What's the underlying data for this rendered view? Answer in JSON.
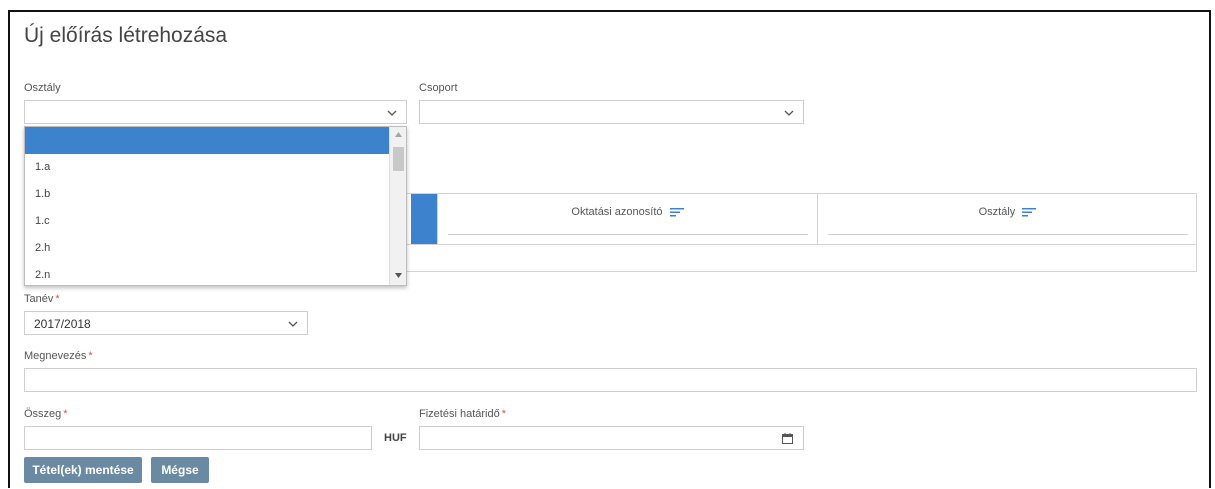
{
  "page": {
    "title": "Új előírás létrehozása"
  },
  "class_select": {
    "label": "Osztály",
    "value": "",
    "icon": "chevron-down-icon",
    "options": [
      "",
      "1.a",
      "1.b",
      "1.c",
      "2.h",
      "2.n"
    ],
    "selected_color": "#3d82cc"
  },
  "group_select": {
    "label": "Csoport",
    "value": "",
    "icon": "chevron-down-icon"
  },
  "table": {
    "columns": [
      {
        "label": "Oktatási azonosító",
        "icon": "filter-icon"
      },
      {
        "label": "Osztály",
        "icon": "filter-icon"
      }
    ]
  },
  "school_year": {
    "label": "Tanév",
    "required_mark": "*",
    "value": "2017/2018"
  },
  "name_field": {
    "label": "Megnevezés",
    "required_mark": "*",
    "value": ""
  },
  "amount_field": {
    "label": "Összeg",
    "required_mark": "*",
    "value": "",
    "unit": "HUF"
  },
  "due_date_field": {
    "label": "Fizetési határidő",
    "required_mark": "*",
    "value": "",
    "icon": "calendar-icon"
  },
  "buttons": {
    "save_label": "Tétel(ek) mentése",
    "cancel_label": "Mégse",
    "color": "#6a8aa3"
  }
}
